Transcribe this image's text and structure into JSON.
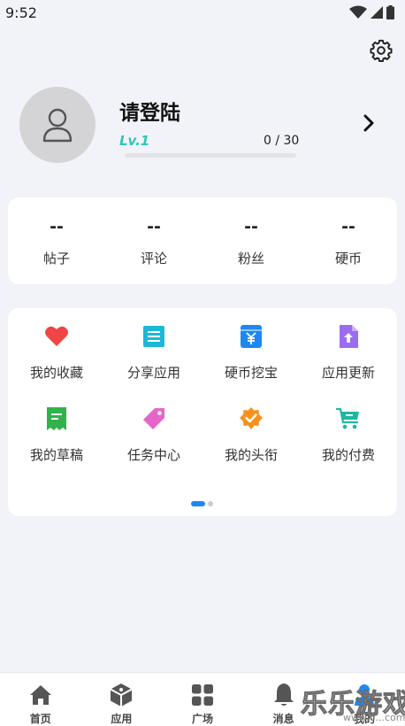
{
  "status_bar": {
    "time": "9:52"
  },
  "profile": {
    "username": "请登陆",
    "level": "Lv.1",
    "exp": "0 / 30",
    "exp_progress": 0
  },
  "stats": [
    {
      "value": "--",
      "label": "帖子"
    },
    {
      "value": "--",
      "label": "评论"
    },
    {
      "value": "--",
      "label": "粉丝"
    },
    {
      "value": "--",
      "label": "硬币"
    }
  ],
  "functions": [
    {
      "label": "我的收藏",
      "icon": "heart-icon",
      "color": "#ef4545"
    },
    {
      "label": "分享应用",
      "icon": "document-icon",
      "color": "#1cb8d6"
    },
    {
      "label": "硬币挖宝",
      "icon": "yen-coin-icon",
      "color": "#1e88f0"
    },
    {
      "label": "应用更新",
      "icon": "upload-file-icon",
      "color": "#9a6cf0"
    },
    {
      "label": "我的草稿",
      "icon": "draft-icon",
      "color": "#31b24b"
    },
    {
      "label": "任务中心",
      "icon": "tag-icon",
      "color": "#e466c9"
    },
    {
      "label": "我的头衔",
      "icon": "badge-icon",
      "color": "#f5921f"
    },
    {
      "label": "我的付费",
      "icon": "cart-icon",
      "color": "#1fb6a2"
    }
  ],
  "pager": {
    "pages": 2,
    "current": 1
  },
  "tabs": [
    {
      "label": "首页",
      "icon": "home-icon"
    },
    {
      "label": "应用",
      "icon": "cube-icon"
    },
    {
      "label": "广场",
      "icon": "grid-icon"
    },
    {
      "label": "消息",
      "icon": "bell-icon"
    },
    {
      "label": "我的",
      "icon": "user-icon"
    }
  ],
  "watermark": {
    "title": "乐乐游戏",
    "url": "www.6...com"
  }
}
